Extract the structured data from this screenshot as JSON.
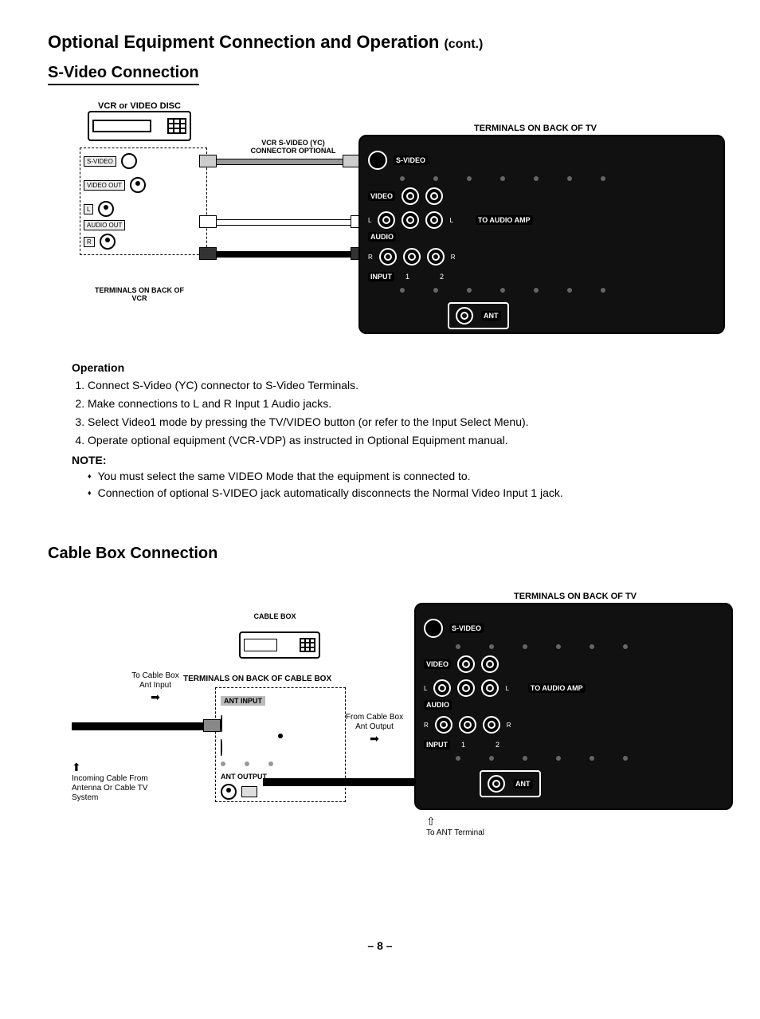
{
  "page": {
    "title_main": "Optional Equipment Connection and Operation",
    "title_cont": "(cont.)",
    "page_number": "– 8 –"
  },
  "svideo": {
    "heading": "S-Video Connection",
    "source_device_label": "VCR or VIDEO DISC",
    "vcr_terminals_caption": "TERMINALS ON BACK OF VCR",
    "vcr_terms": {
      "svideo": "S-VIDEO",
      "video_out": "VIDEO OUT",
      "audio_out": "AUDIO OUT",
      "l": "L",
      "r": "R"
    },
    "connector_label": "VCR S-VIDEO (YC) CONNECTOR OPTIONAL",
    "tv_terminals_caption": "TERMINALS ON BACK OF TV",
    "tv_labels": {
      "svideo": "S-VIDEO",
      "video": "VIDEO",
      "audio": "AUDIO",
      "l": "L",
      "r": "R",
      "to_audio_amp": "TO AUDIO AMP",
      "input": "INPUT",
      "input1": "1",
      "input2": "2",
      "ant": "ANT"
    },
    "operation_heading": "Operation",
    "operation_steps": [
      "Connect S-Video (YC) connector to S-Video Terminals.",
      "Make connections to L and R Input 1 Audio jacks.",
      "Select Video1 mode by pressing the TV/VIDEO button (or refer to the Input Select Menu).",
      "Operate optional equipment (VCR-VDP) as instructed in Optional Equipment manual."
    ],
    "note_heading": "NOTE:",
    "notes": [
      "You must select the same VIDEO Mode that the equipment is connected to.",
      "Connection of optional S-VIDEO jack automatically disconnects the Normal Video Input 1 jack."
    ]
  },
  "cablebox": {
    "heading": "Cable Box Connection",
    "cablebox_label": "CABLE BOX",
    "cb_terminals_caption": "TERMINALS ON BACK OF CABLE BOX",
    "ant_input": "ANT INPUT",
    "ant_output": "ANT OUTPUT",
    "to_cable_box_ant_input": "To Cable Box Ant Input",
    "from_cable_box_ant_output": "From Cable Box Ant Output",
    "incoming_cable": "Incoming Cable From Antenna Or Cable TV System",
    "tv_terminals_caption": "TERMINALS ON BACK OF TV",
    "to_ant_terminal": "To ANT Terminal",
    "tv_labels": {
      "svideo": "S-VIDEO",
      "video": "VIDEO",
      "audio": "AUDIO",
      "l": "L",
      "r": "R",
      "to_audio_amp": "TO AUDIO AMP",
      "input": "INPUT",
      "input1": "1",
      "input2": "2",
      "ant": "ANT"
    }
  }
}
